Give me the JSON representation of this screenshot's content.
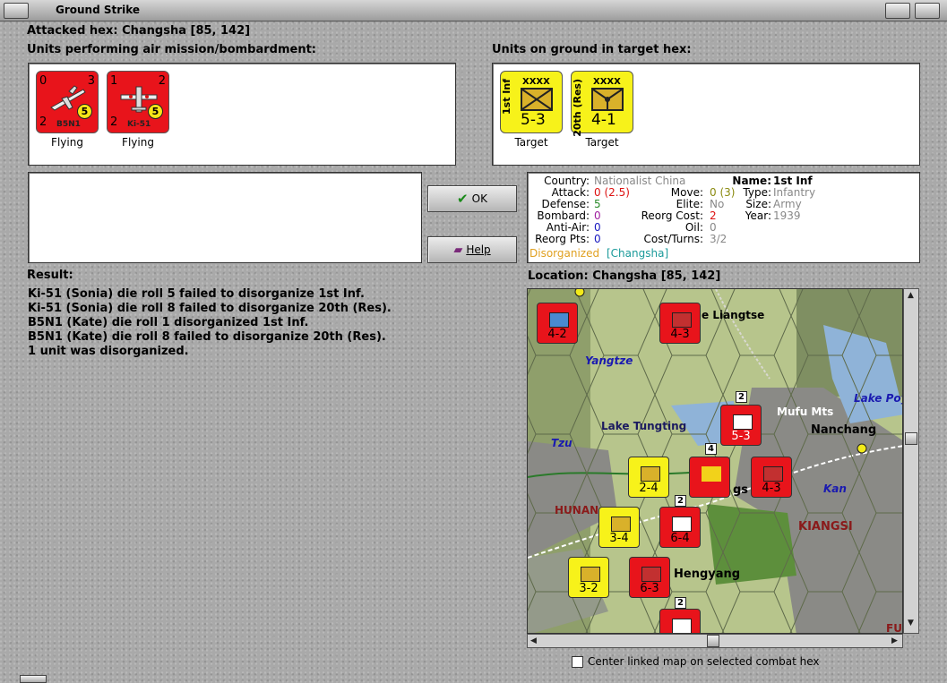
{
  "window": {
    "title": "Ground Strike"
  },
  "attacked_hex": "Attacked hex: Changsha  [85, 142]",
  "air_panel": {
    "label": "Units performing air mission/bombardment:",
    "units": [
      {
        "type": "B5N1",
        "nw": "0",
        "ne": "3",
        "sw": "2",
        "range": "5",
        "caption": "Flying"
      },
      {
        "type": "Ki-51",
        "nw": "1",
        "ne": "2",
        "sw": "2",
        "range": "5",
        "caption": "Flying"
      }
    ]
  },
  "ground_panel": {
    "label": "Units on ground in target hex:",
    "units": [
      {
        "name": "1st Inf",
        "size": "XXXX",
        "strength": "5-3",
        "caption": "Target"
      },
      {
        "name": "20th (Res)",
        "size": "XXXX",
        "strength": "4-1",
        "caption": "Target"
      }
    ]
  },
  "buttons": {
    "ok": "OK",
    "help": "Help"
  },
  "unit_info": {
    "country_k": "Country:",
    "country_v": "Nationalist China",
    "attack_k": "Attack:",
    "attack_v": "0",
    "attack_v2": "(2.5)",
    "defense_k": "Defense:",
    "defense_v": "5",
    "bombard_k": "Bombard:",
    "bombard_v": "0",
    "antiair_k": "Anti-Air:",
    "antiair_v": "0",
    "reorg_k": "Reorg Pts:",
    "reorg_v": "0",
    "move_k": "Move:",
    "move_v": "0",
    "move_v2": "(3)",
    "elite_k": "Elite:",
    "elite_v": "No",
    "reorgcost_k": "Reorg Cost:",
    "reorgcost_v": "2",
    "oil_k": "Oil:",
    "oil_v": "0",
    "costturns_k": "Cost/Turns:",
    "costturns_v": "3/2",
    "name_k": "Name:",
    "name_v": "1st Inf",
    "type_k": "Type:",
    "type_v": "Infantry",
    "size_k": "Size:",
    "size_v": "Army",
    "year_k": "Year:",
    "year_v": "1939",
    "status": "Disorganized",
    "location_tag": "[Changsha]"
  },
  "result": {
    "label": "Result:",
    "lines": [
      "Ki-51 (Sonia) die roll 5 failed to disorganize 1st Inf.",
      "Ki-51 (Sonia) die roll 8 failed to disorganize 20th (Res).",
      "B5N1 (Kate) die roll 1 disorganized 1st Inf.",
      "B5N1 (Kate) die roll 8 failed to disorganize 20th (Res).",
      "1 unit was disorganized."
    ]
  },
  "location": {
    "label": "Location:  Changsha  [85, 142]",
    "map_labels": {
      "lake_liangtse": "e Liangtse",
      "yangtze": "Yangtze",
      "lake_poy": "Lake Poy",
      "mufu": "Mufu Mts",
      "lake_tungting": "Lake Tungting",
      "nanchang": "Nanchang",
      "tzu": "Tzu",
      "kan": "Kan",
      "hunan": "HUNAN",
      "kiangsi": "KIANGSI",
      "hengyang": "Hengyang",
      "changsha_frag": "gs",
      "fu": "FU"
    },
    "map_counters": [
      {
        "strength": "4-2",
        "color": "red"
      },
      {
        "strength": "4-3",
        "color": "red"
      },
      {
        "strength": "5-3",
        "color": "red"
      },
      {
        "strength": "2-4",
        "color": "yellow"
      },
      {
        "strength": "4-3",
        "color": "red"
      },
      {
        "strength": "3-4",
        "color": "yellow"
      },
      {
        "strength": "6-4",
        "color": "red"
      },
      {
        "strength": "3-2",
        "color": "yellow"
      },
      {
        "strength": "6-3",
        "color": "red"
      }
    ],
    "stack_badges": [
      "2",
      "4",
      "2",
      "2"
    ]
  },
  "checkbox": {
    "label": "Center linked map on selected combat hex",
    "checked": false
  }
}
